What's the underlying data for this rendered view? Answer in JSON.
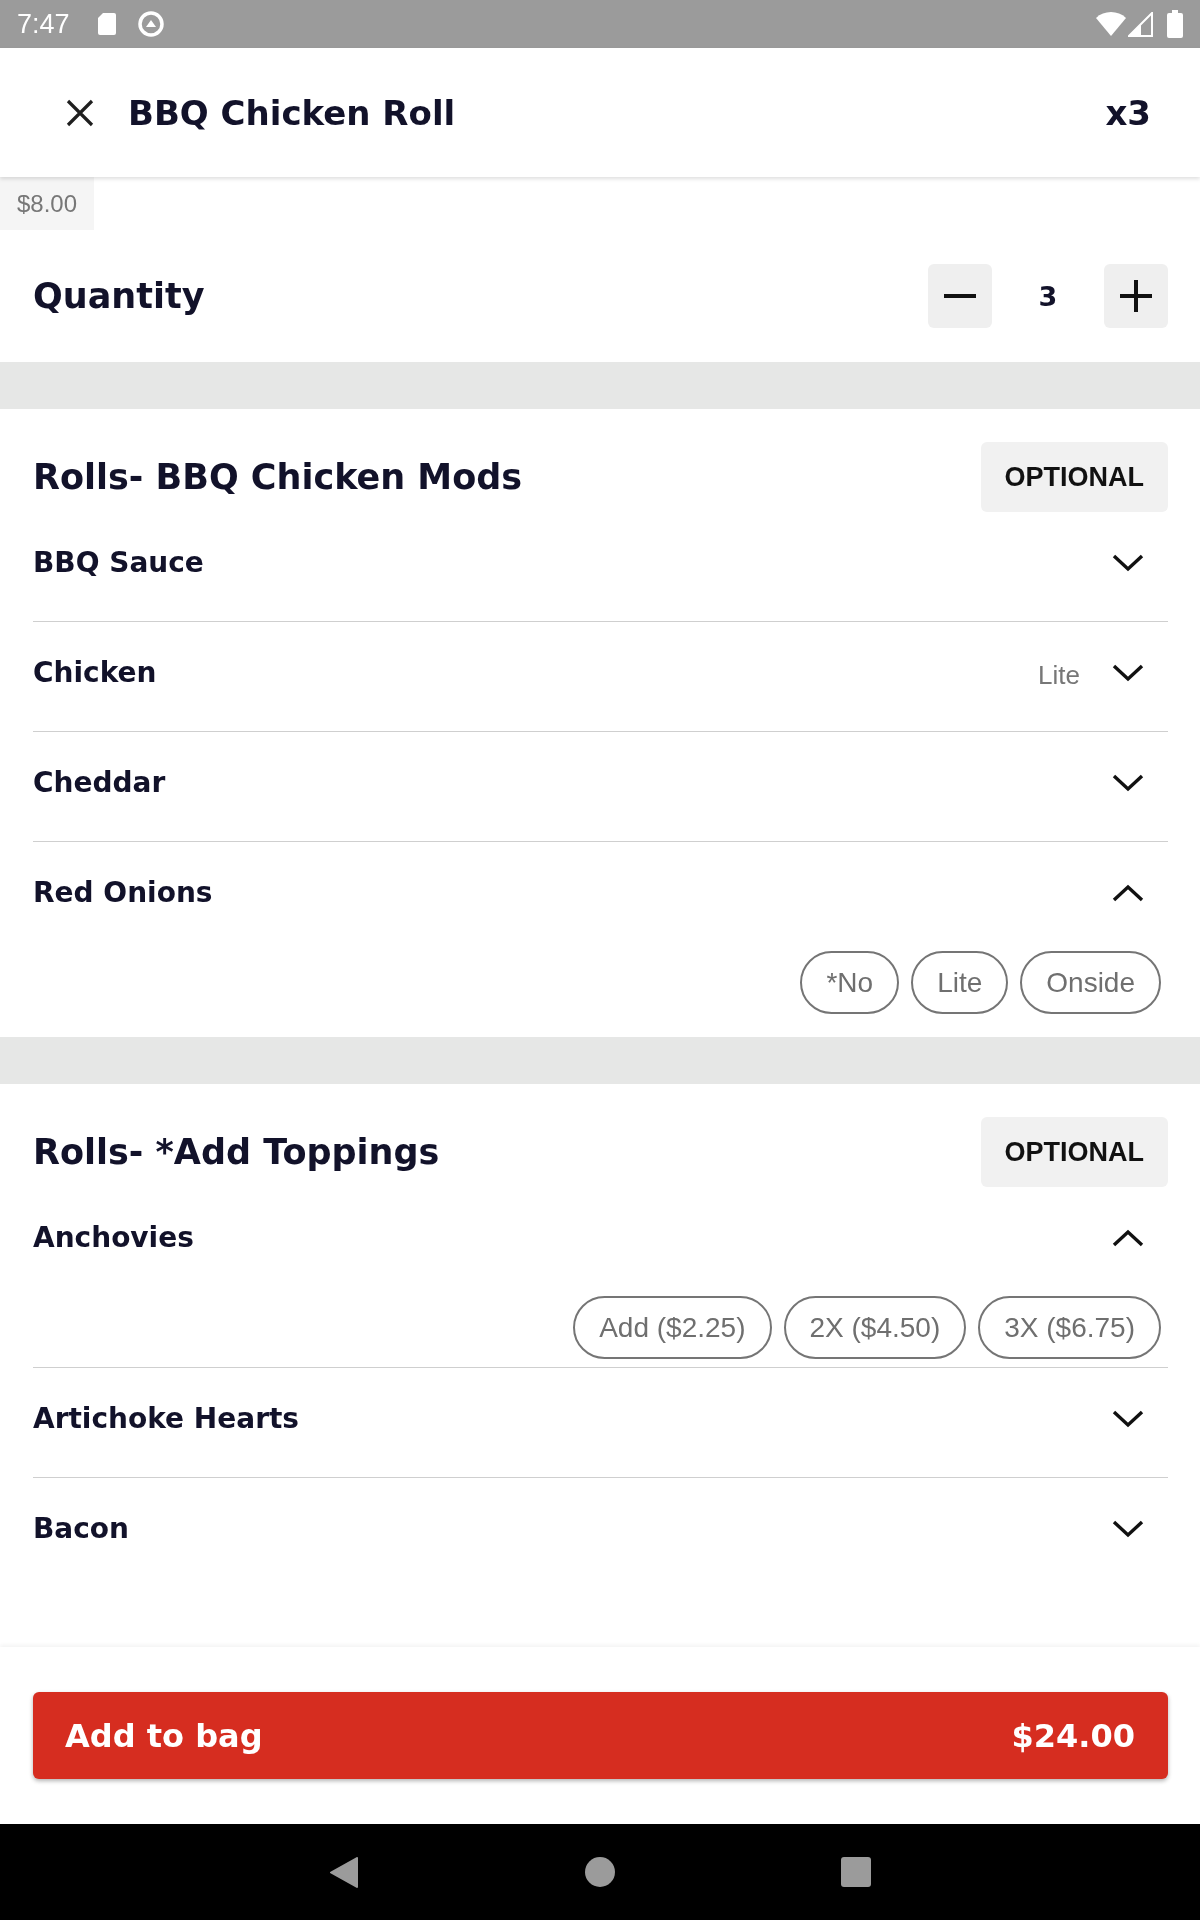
{
  "status_bar": {
    "time": "7:47"
  },
  "header": {
    "title": "BBQ Chicken Roll",
    "count": "x3"
  },
  "base_price": "$8.00",
  "quantity": {
    "label": "Quantity",
    "value": "3"
  },
  "sections": [
    {
      "title": "Rolls- BBQ Chicken Mods",
      "badge": "OPTIONAL",
      "items": [
        {
          "name": "BBQ Sauce",
          "expanded": false
        },
        {
          "name": "Chicken",
          "selection": "Lite",
          "expanded": false
        },
        {
          "name": "Cheddar",
          "expanded": false
        },
        {
          "name": "Red Onions",
          "expanded": true,
          "options": [
            {
              "label": "*No",
              "selected": false
            },
            {
              "label": "Lite",
              "selected": false
            },
            {
              "label": "Onside",
              "selected": false
            }
          ]
        }
      ]
    },
    {
      "title": "Rolls- *Add Toppings",
      "badge": "OPTIONAL",
      "items": [
        {
          "name": "Anchovies",
          "expanded": true,
          "options": [
            {
              "label": "Add ($2.25)",
              "selected": false
            },
            {
              "label": "2X ($4.50)",
              "selected": false
            },
            {
              "label": "3X ($6.75)",
              "selected": false
            }
          ]
        },
        {
          "name": "Artichoke Hearts",
          "expanded": false
        },
        {
          "name": "Bacon",
          "expanded": false
        }
      ]
    }
  ],
  "add_to_bag": {
    "label": "Add to bag",
    "total": "$24.00"
  }
}
